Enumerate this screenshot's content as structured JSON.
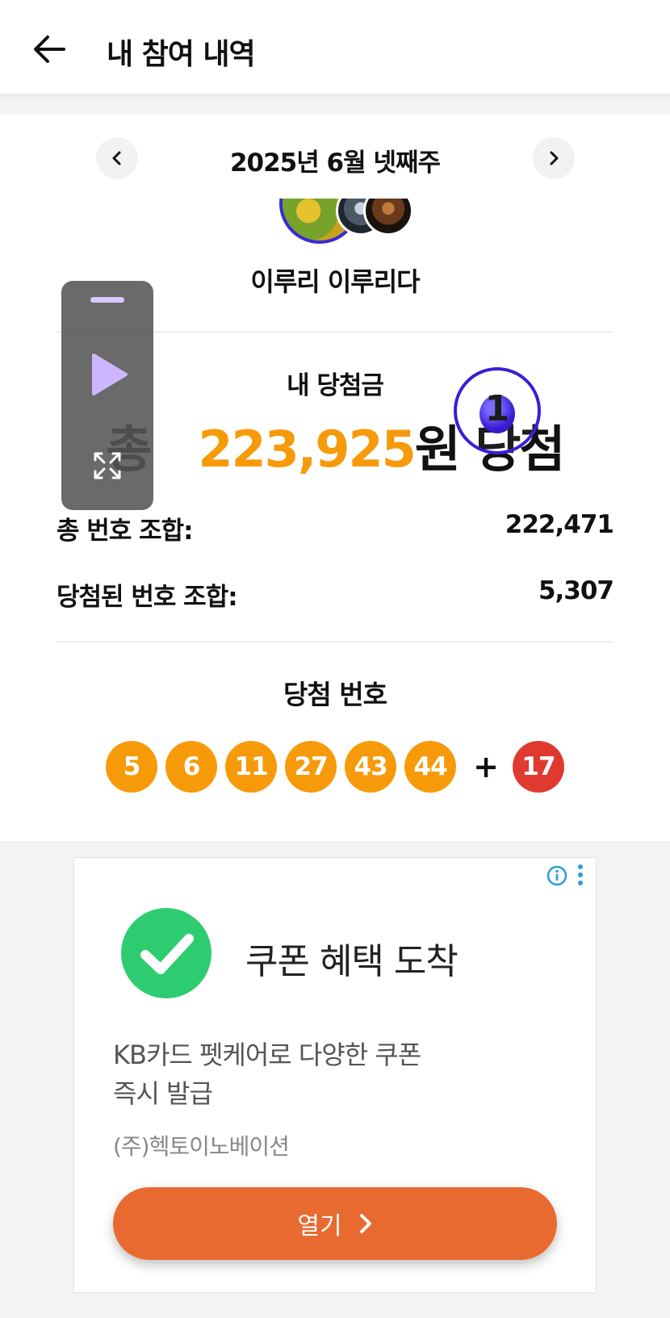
{
  "header": {
    "back_icon": "arrow-left-icon",
    "title": "내 참여 내역"
  },
  "week_nav": {
    "prev_icon": "chevron-left-icon",
    "label": "2025년 6월 넷째주",
    "next_icon": "chevron-right-icon"
  },
  "participant": {
    "name": "이루리 이루리다"
  },
  "prize": {
    "label": "내 당첨금",
    "prefix": "총",
    "amount": "223,925",
    "suffix": "원 당첨"
  },
  "stats": {
    "total_label": "총 번호 조합:",
    "total_value": "222,471",
    "winning_label": "당첨된 번호 조합:",
    "winning_value": "5,307"
  },
  "winning_numbers": {
    "label": "당첨 번호",
    "numbers": [
      "5",
      "6",
      "11",
      "27",
      "43",
      "44"
    ],
    "plus": "+",
    "bonus": "17",
    "main_color": "#f79a0a",
    "bonus_color": "#e0392f"
  },
  "floating_widget": {
    "play_icon": "play-icon",
    "expand_icon": "expand-icon",
    "bubble_number": "1"
  },
  "ad": {
    "title": "쿠폰 혜택 도착",
    "description_line1": "KB카드 펫케어로 다양한 쿠폰",
    "description_line2": "즉시 발급",
    "advertiser": "(주)헥토이노베이션",
    "button_label": "열기",
    "button_color": "#e86a30",
    "check_color": "#2ecc71"
  }
}
